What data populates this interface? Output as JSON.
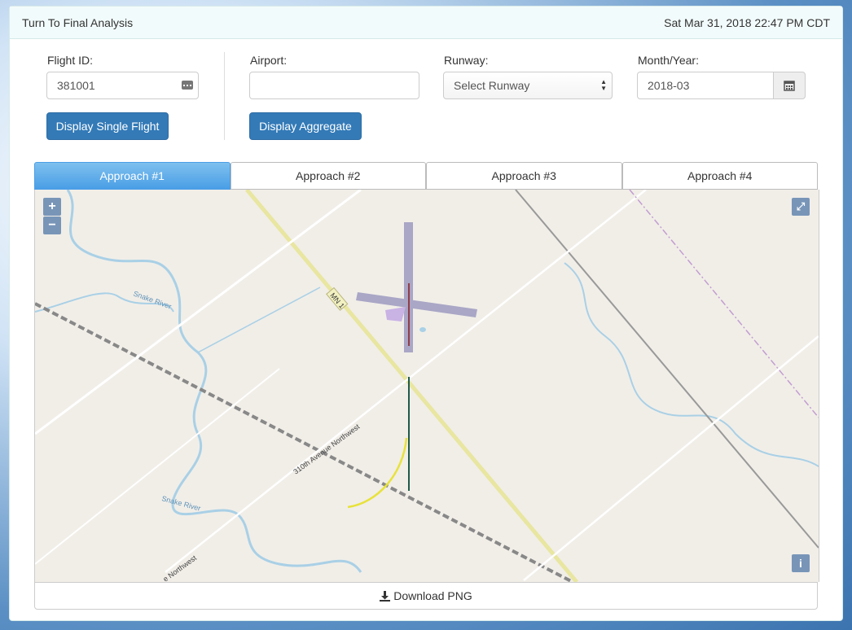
{
  "header": {
    "title": "Turn To Final Analysis",
    "datetime": "Sat Mar 31, 2018 22:47 PM CDT"
  },
  "form": {
    "flight_id_label": "Flight ID:",
    "flight_id_value": "381001",
    "airport_label": "Airport:",
    "airport_value": "",
    "runway_label": "Runway:",
    "runway_selected": "Select Runway",
    "month_year_label": "Month/Year:",
    "month_year_value": "2018-03",
    "single_flight_button": "Display Single Flight",
    "aggregate_button": "Display Aggregate"
  },
  "tabs": [
    {
      "label": "Approach #1",
      "active": true
    },
    {
      "label": "Approach #2",
      "active": false
    },
    {
      "label": "Approach #3",
      "active": false
    },
    {
      "label": "Approach #4",
      "active": false
    }
  ],
  "map": {
    "zoom_in": "+",
    "zoom_out": "−",
    "info_label": "i",
    "labels": {
      "river_1": "Snake River",
      "river_2": "Snake River",
      "road_1": "310th Avenue Northwest",
      "road_2": "e Northwest",
      "highway": "MN 1"
    },
    "colors": {
      "track": "#1f5a4a",
      "turn": "#e8e23a",
      "runway": "#a9a6c6",
      "centerline": "#8b1a1a"
    }
  },
  "footer": {
    "download_label": "Download PNG"
  }
}
